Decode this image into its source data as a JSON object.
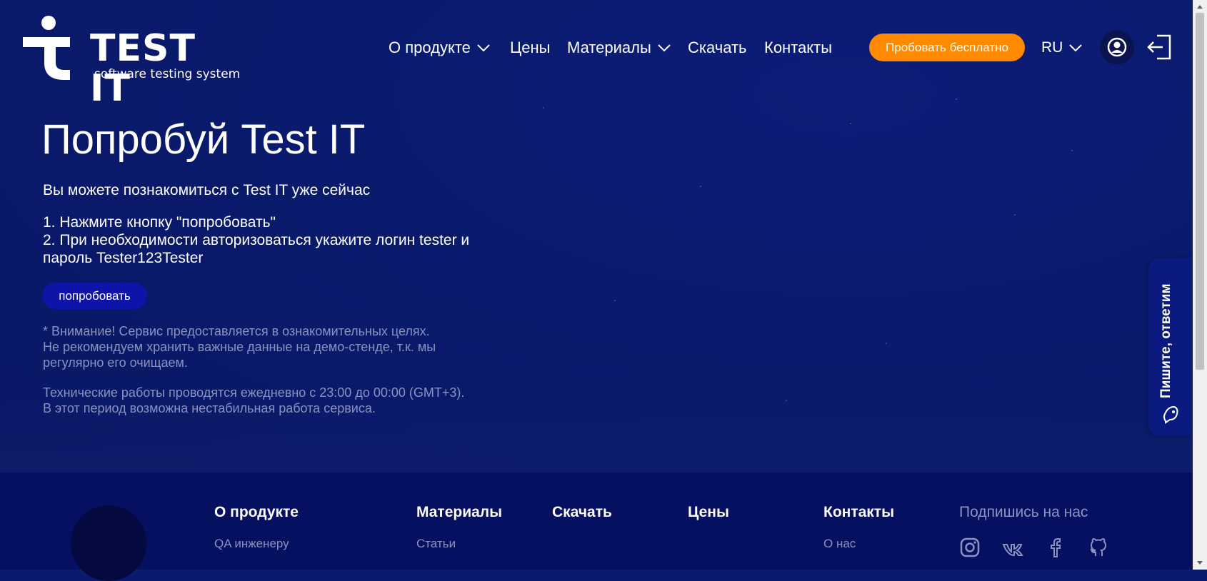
{
  "header": {
    "logo": {
      "name": "TEST IT",
      "tagline": "software testing system"
    },
    "nav": [
      {
        "label": "О продукте",
        "has_dropdown": true
      },
      {
        "label": "Цены",
        "has_dropdown": false
      },
      {
        "label": "Материалы",
        "has_dropdown": true
      },
      {
        "label": "Скачать",
        "has_dropdown": false
      },
      {
        "label": "Контакты",
        "has_dropdown": false
      }
    ],
    "cta_label": "Пробовать бесплатно",
    "language": "RU",
    "icons": {
      "user": "user-icon",
      "login": "login-icon"
    }
  },
  "main": {
    "title": "Попробуй Test IT",
    "subtitle": "Вы можете познакомиться с Test IT уже сейчас",
    "steps": [
      "1. Нажмите кнопку \"попробовать\"",
      "2. При необходимости авторизоваться укажите логин tester и",
      "пароль Tester123Tester"
    ],
    "button_label": "попробовать",
    "notice_lines": [
      "* Внимание! Сервис предоставляется в ознакомительных целях.",
      "Не рекомендуем хранить важные данные на демо-стенде, т.к. мы",
      "регулярно его очищаем."
    ],
    "maintenance_lines": [
      "Технические работы проводятся ежедневно с 23:00 до 00:00 (GMT+3).",
      "В этот период возможна нестабильная работа сервиса."
    ]
  },
  "feedback_tab": {
    "label": "Пишите, ответим",
    "icon": "chat-bot-icon"
  },
  "footer": {
    "columns": [
      {
        "heading": "О продукте",
        "links": [
          "QA инженеру"
        ]
      },
      {
        "heading": "Материалы",
        "links": [
          "Статьи"
        ]
      },
      {
        "heading": "Скачать",
        "links": []
      },
      {
        "heading": "Цены",
        "links": []
      },
      {
        "heading": "Контакты",
        "links": [
          "О нас"
        ]
      }
    ],
    "follow_label": "Подпишись на нас",
    "social_icons": [
      "instagram-icon",
      "vk-icon",
      "facebook-icon",
      "github-icon"
    ]
  },
  "colors": {
    "background": "#0a1a6e",
    "accent_orange": "#ff8a00",
    "demo_button": "#0e14a8",
    "footer": "#061060",
    "muted_text": "#8a93bf"
  }
}
